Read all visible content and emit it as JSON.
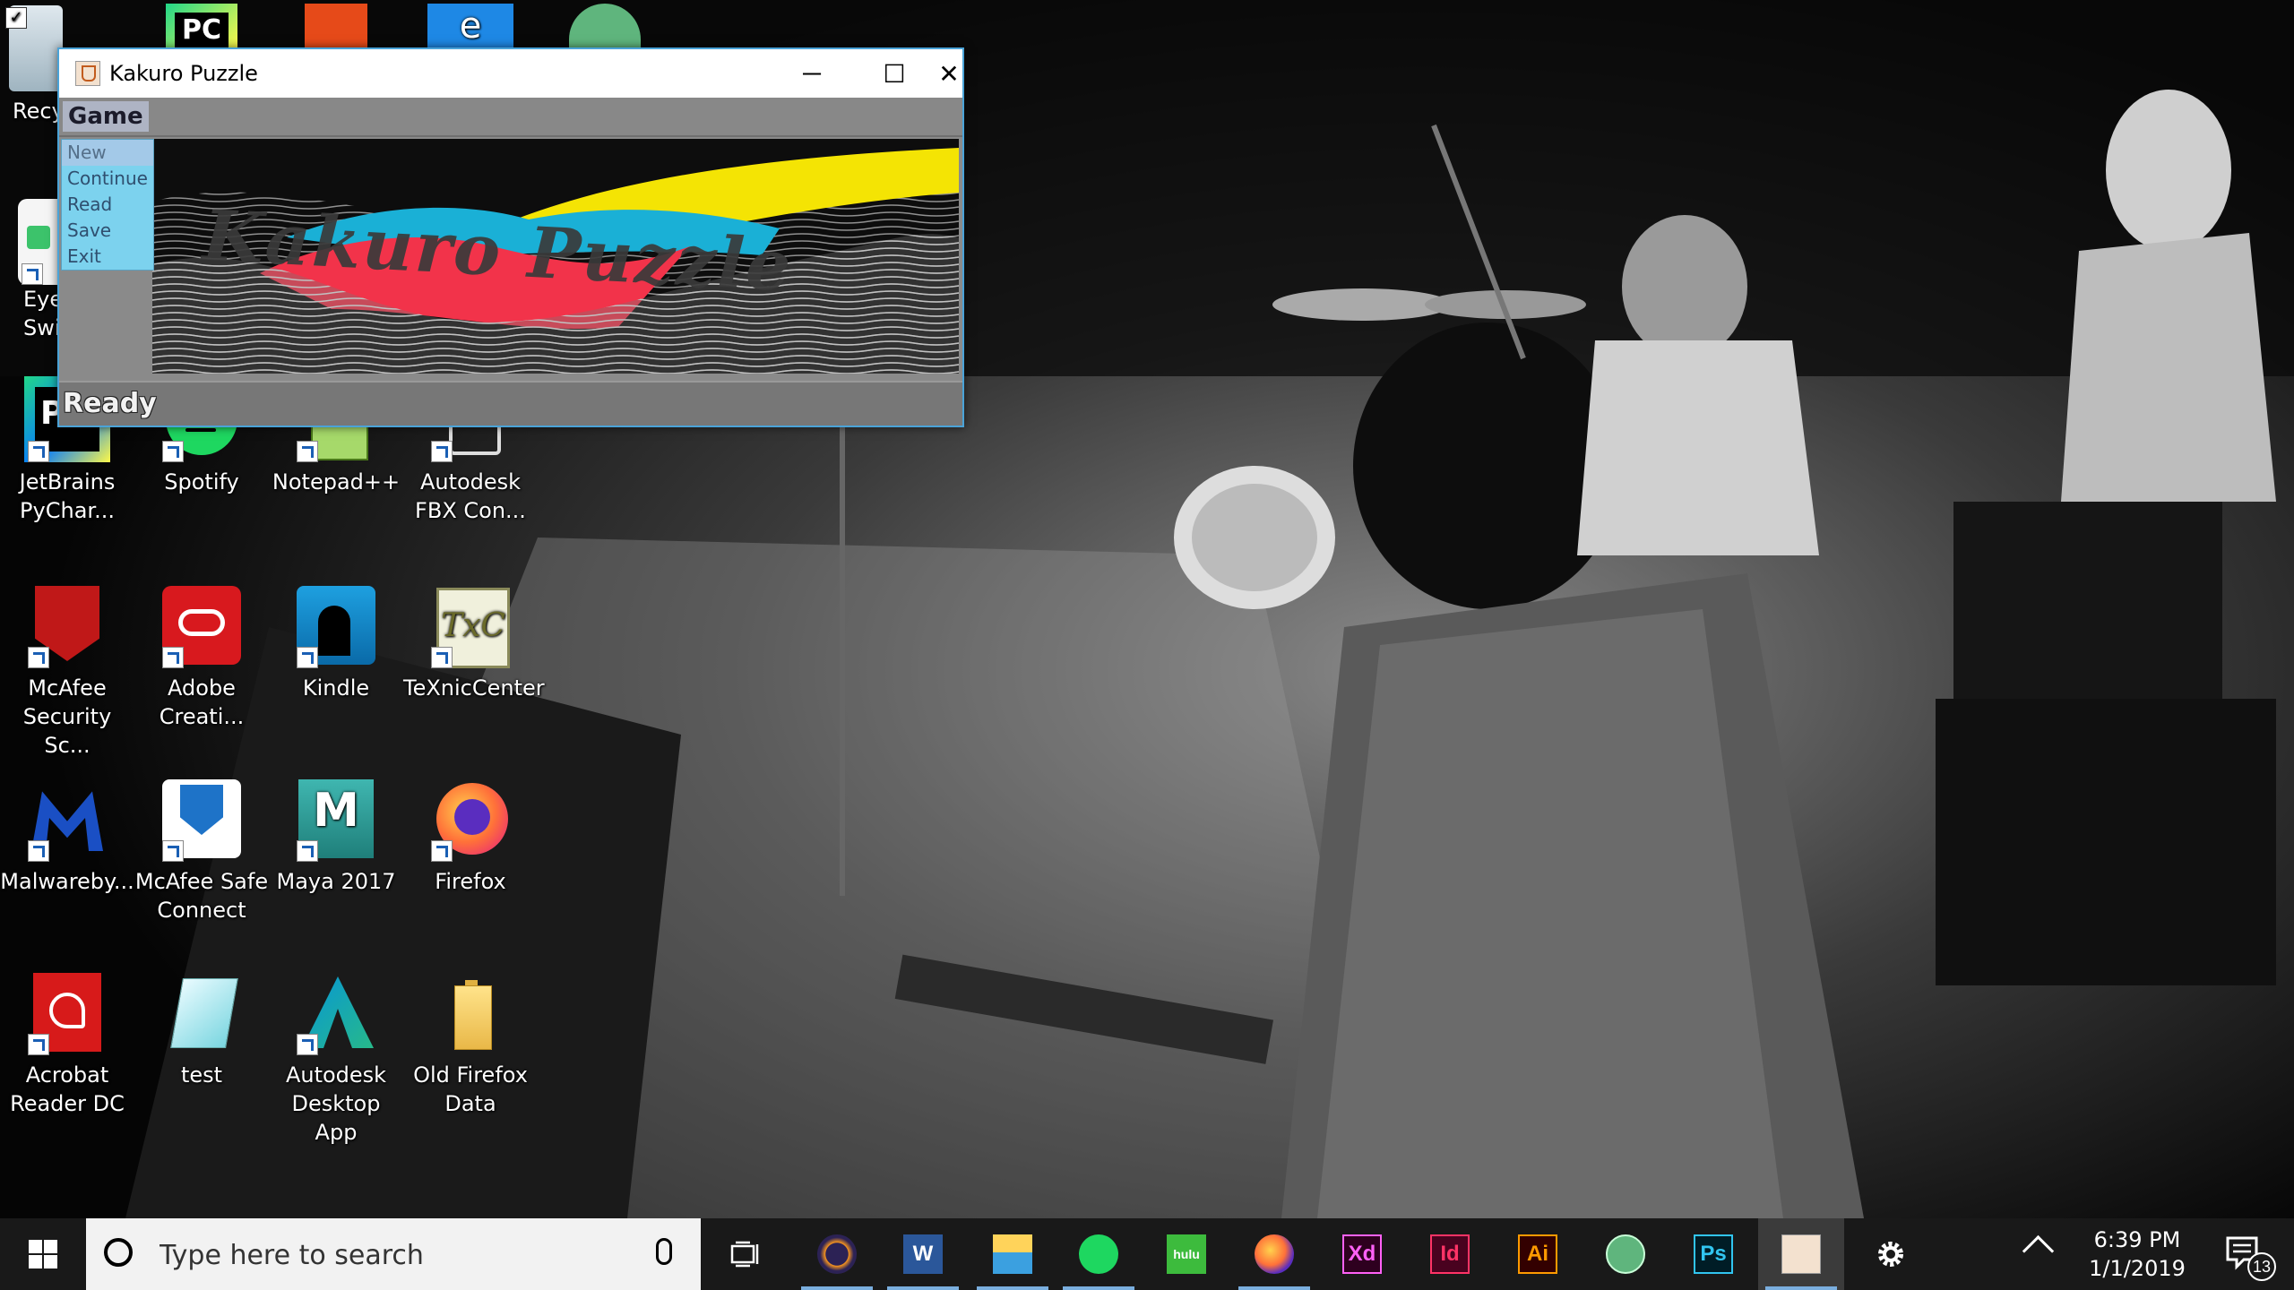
{
  "desktop": {
    "icons": [
      {
        "id": "recycle",
        "label": "Recy"
      },
      {
        "id": "pycharm-top",
        "label": ""
      },
      {
        "id": "office",
        "label": ""
      },
      {
        "id": "edge",
        "label": ""
      },
      {
        "id": "atom-top",
        "label": ""
      },
      {
        "id": "eyeswitch",
        "label1": "Eye",
        "label2": "Swi"
      },
      {
        "id": "pycharm",
        "label1": "JetBrains",
        "label2": "PyChar..."
      },
      {
        "id": "spotify",
        "label1": "Spotify",
        "label2": ""
      },
      {
        "id": "notepadpp",
        "label1": "Notepad++",
        "label2": ""
      },
      {
        "id": "fbx",
        "label1": "Autodesk",
        "label2": "FBX Con..."
      },
      {
        "id": "mcafee",
        "label1": "McAfee",
        "label2": "Security Sc..."
      },
      {
        "id": "adobe-cc",
        "label1": "Adobe",
        "label2": "Creati..."
      },
      {
        "id": "kindle",
        "label1": "Kindle",
        "label2": ""
      },
      {
        "id": "texnic",
        "label1": "TeXnicCenter",
        "label2": ""
      },
      {
        "id": "malwarebytes",
        "label1": "Malwareby...",
        "label2": ""
      },
      {
        "id": "mcafee-safe",
        "label1": "McAfee Safe",
        "label2": "Connect"
      },
      {
        "id": "maya",
        "label1": "Maya 2017",
        "label2": ""
      },
      {
        "id": "firefox",
        "label1": "Firefox",
        "label2": ""
      },
      {
        "id": "acrobat",
        "label1": "Acrobat",
        "label2": "Reader DC"
      },
      {
        "id": "test",
        "label1": "test",
        "label2": ""
      },
      {
        "id": "autodesk-app",
        "label1": "Autodesk",
        "label2": "Desktop App"
      },
      {
        "id": "old-firefox",
        "label1": "Old Firefox",
        "label2": "Data"
      }
    ]
  },
  "window": {
    "title": "Kakuro Puzzle",
    "menu": {
      "game": "Game"
    },
    "dropdown": [
      "New",
      "Continue",
      "Read",
      "Save",
      "Exit"
    ],
    "banner_text": "Kakuro Puzzle",
    "status": "Ready",
    "controls": {
      "minimize": "─",
      "maximize": "☐",
      "close": "✕"
    }
  },
  "taskbar": {
    "search_placeholder": "Type here to search",
    "apps": [
      {
        "name": "eclipse",
        "text": ""
      },
      {
        "name": "word",
        "text": "W"
      },
      {
        "name": "file-explorer",
        "text": ""
      },
      {
        "name": "spotify",
        "text": ""
      },
      {
        "name": "hulu",
        "text": "hulu"
      },
      {
        "name": "firefox",
        "text": ""
      },
      {
        "name": "adobe-xd",
        "text": "Xd"
      },
      {
        "name": "indesign",
        "text": "Id"
      },
      {
        "name": "illustrator",
        "text": "Ai"
      },
      {
        "name": "atom",
        "text": ""
      },
      {
        "name": "photoshop",
        "text": "Ps"
      },
      {
        "name": "java",
        "text": ""
      },
      {
        "name": "settings",
        "text": ""
      }
    ],
    "time": "6:39 PM",
    "date": "1/1/2019",
    "notification_count": "13"
  },
  "colors": {
    "window_border": "#4aa3d8",
    "dropdown_bg": "#7cd2ee",
    "taskbar_bg": "#191919",
    "accent": "#7aaede"
  }
}
